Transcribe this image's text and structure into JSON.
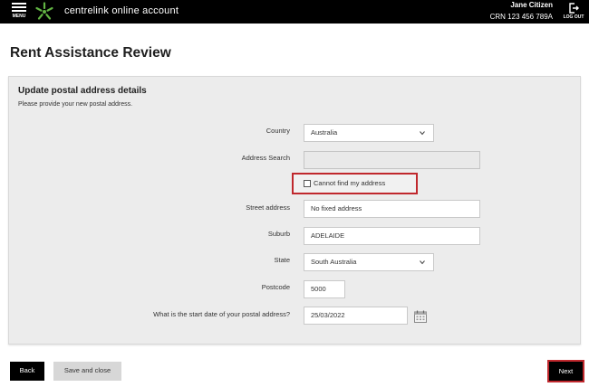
{
  "topbar": {
    "menu_label": "MENU",
    "app_title": "centrelink online account",
    "user_name": "Jane Citizen",
    "crn": "CRN 123 456 789A",
    "logout_label": "LOG OUT",
    "logo_color": "#62b443",
    "logo_icon": "centrelink-star-logo"
  },
  "page": {
    "title": "Rent Assistance Review"
  },
  "form": {
    "title": "Update postal address details",
    "subtitle": "Please provide your new postal address.",
    "country_label": "Country",
    "country_value": "Australia",
    "address_search_label": "Address Search",
    "address_search_value": "",
    "cannot_find_label": "Cannot find my address",
    "cannot_find_checked": false,
    "street_label": "Street address",
    "street_value": "No fixed address",
    "suburb_label": "Suburb",
    "suburb_value": "ADELAIDE",
    "state_label": "State",
    "state_value": "South Australia",
    "postcode_label": "Postcode",
    "postcode_value": "5000",
    "start_date_label": "What is the start date of your postal address?",
    "start_date_value": "25/03/2022",
    "date_icon": "calendar-icon"
  },
  "buttons": {
    "back": "Back",
    "save_close": "Save and close",
    "next": "Next"
  },
  "colors": {
    "highlight": "#c0282d",
    "topbar_bg": "#000000",
    "panel_bg": "#ececec"
  }
}
